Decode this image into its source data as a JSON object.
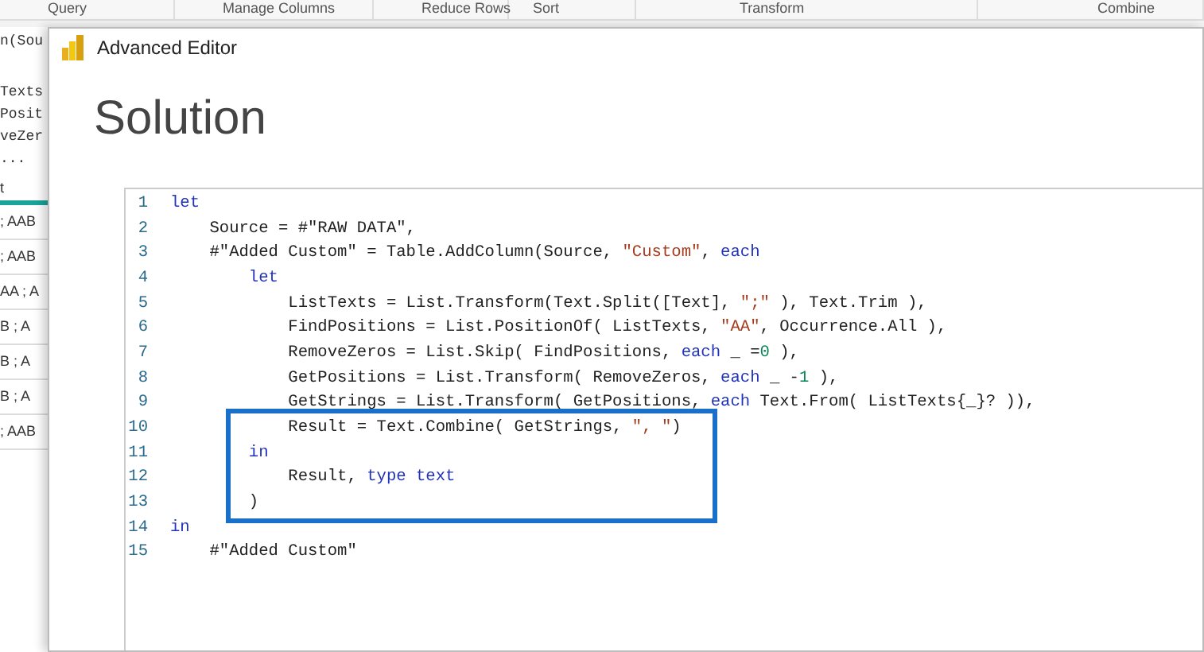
{
  "ribbon": [
    "Query",
    "Manage Columns",
    "Reduce Rows",
    "Sort",
    "Transform",
    "Combine"
  ],
  "background_pane": {
    "formula": "n(Sou",
    "steps": [
      "Texts",
      "Posit",
      "veZer",
      "..."
    ],
    "column_header": "t",
    "rows": [
      "; AAB",
      "; AAB",
      "AA ; A",
      "B ; A",
      "B ; A",
      "B ; A",
      "; AAB"
    ]
  },
  "window": {
    "title": "Advanced Editor",
    "heading": "Solution"
  },
  "editor": {
    "lines": [
      {
        "number": "1",
        "tokens": [
          {
            "text": "let",
            "kind": "keyword"
          }
        ]
      },
      {
        "number": "2",
        "tokens": [
          {
            "text": "    Source = #\"RAW DATA\",",
            "kind": "plain"
          }
        ]
      },
      {
        "number": "3",
        "tokens": [
          {
            "text": "    #\"Added Custom\" = Table.AddColumn(Source, ",
            "kind": "plain"
          },
          {
            "text": "\"Custom\"",
            "kind": "string"
          },
          {
            "text": ", ",
            "kind": "plain"
          },
          {
            "text": "each",
            "kind": "keyword"
          }
        ]
      },
      {
        "number": "4",
        "tokens": [
          {
            "text": "        let",
            "kind": "keyword"
          }
        ]
      },
      {
        "number": "5",
        "tokens": [
          {
            "text": "            ListTexts = List.Transform(Text.Split([Text], ",
            "kind": "plain"
          },
          {
            "text": "\";\"",
            "kind": "string"
          },
          {
            "text": " ), Text.Trim ),",
            "kind": "plain"
          }
        ]
      },
      {
        "number": "6",
        "tokens": [
          {
            "text": "            FindPositions = List.PositionOf( ListTexts, ",
            "kind": "plain"
          },
          {
            "text": "\"AA\"",
            "kind": "string"
          },
          {
            "text": ", Occurrence.All ),",
            "kind": "plain"
          }
        ]
      },
      {
        "number": "7",
        "tokens": [
          {
            "text": "            RemoveZeros = List.Skip( FindPositions, ",
            "kind": "plain"
          },
          {
            "text": "each",
            "kind": "keyword"
          },
          {
            "text": " _ =",
            "kind": "plain"
          },
          {
            "text": "0",
            "kind": "number"
          },
          {
            "text": " ),",
            "kind": "plain"
          }
        ]
      },
      {
        "number": "8",
        "tokens": [
          {
            "text": "            GetPositions = List.Transform( RemoveZeros, ",
            "kind": "plain"
          },
          {
            "text": "each",
            "kind": "keyword"
          },
          {
            "text": " _ -",
            "kind": "plain"
          },
          {
            "text": "1",
            "kind": "number"
          },
          {
            "text": " ),",
            "kind": "plain"
          }
        ]
      },
      {
        "number": "9",
        "tokens": [
          {
            "text": "            GetStrings = List.Transform( GetPositions, ",
            "kind": "plain"
          },
          {
            "text": "each",
            "kind": "keyword"
          },
          {
            "text": " Text.From( ListTexts{_}? )),",
            "kind": "plain"
          }
        ]
      },
      {
        "number": "10",
        "tokens": [
          {
            "text": "            Result = Text.Combine( GetStrings, ",
            "kind": "plain"
          },
          {
            "text": "\", \"",
            "kind": "string"
          },
          {
            "text": ")",
            "kind": "plain"
          }
        ]
      },
      {
        "number": "11",
        "tokens": [
          {
            "text": "        in",
            "kind": "keyword"
          }
        ]
      },
      {
        "number": "12",
        "tokens": [
          {
            "text": "            Result, ",
            "kind": "plain"
          },
          {
            "text": "type",
            "kind": "keyword"
          },
          {
            "text": " text",
            "kind": "keyword"
          }
        ]
      },
      {
        "number": "13",
        "tokens": [
          {
            "text": "        )",
            "kind": "plain"
          }
        ]
      },
      {
        "number": "14",
        "tokens": [
          {
            "text": "in",
            "kind": "keyword"
          }
        ]
      },
      {
        "number": "15",
        "tokens": [
          {
            "text": "    #\"Added Custom\"",
            "kind": "plain"
          }
        ]
      }
    ]
  }
}
